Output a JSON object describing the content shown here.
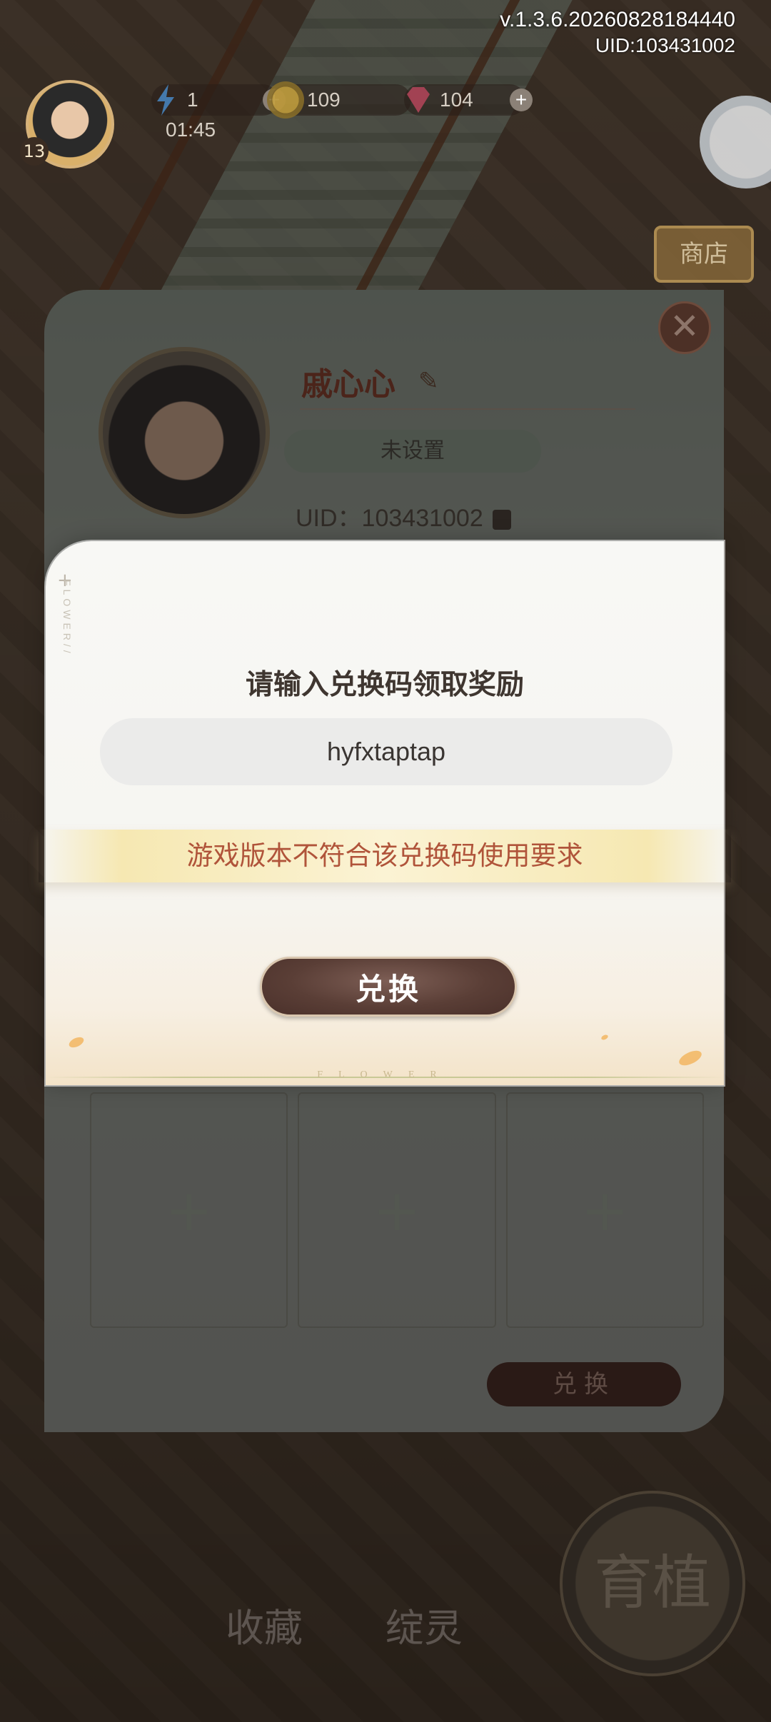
{
  "hud": {
    "version": "v.1.3.6.20260828184440",
    "uid": "UID:103431002",
    "level": "13",
    "energy": "1",
    "timer": "01:45",
    "coins": "109",
    "gems": "104",
    "shop_sign": "商店"
  },
  "profile": {
    "nickname": "戚心心",
    "signature": "未设置",
    "uid_text": "UID：103431002",
    "close_symbol": "✕",
    "slot_plus": "+",
    "exchange_label": "兑换"
  },
  "dialog": {
    "title": "请输入兑换码领取奖励",
    "code_value": "hyfxtaptap",
    "error_message": "游戏版本不符合该兑换码使用要求",
    "button_label": "兑换",
    "side_deco": "FLOWER//",
    "footer_deco": "FLOWER"
  },
  "bottom_nav": {
    "collection": "收藏",
    "spirit": "绽灵",
    "grow": "育植"
  },
  "icons": {
    "energy": "lightning-icon",
    "coin": "coin-icon",
    "gem": "gem-icon",
    "edit": "pencil-icon",
    "copy": "copy-icon",
    "close": "close-icon"
  },
  "colors": {
    "error_text": "#b0543a",
    "button_bg": "#5a3e36",
    "title_text": "#3f3630"
  }
}
